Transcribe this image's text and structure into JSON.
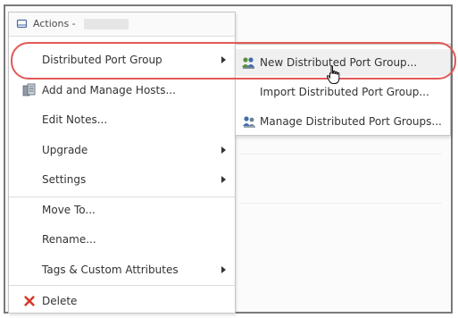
{
  "menu": {
    "header": {
      "title": "Actions -",
      "icon": "switch-icon"
    },
    "items": [
      {
        "label": "Distributed Port Group",
        "icon": "",
        "has_submenu": true
      },
      {
        "label": "Add and Manage Hosts...",
        "icon": "hosts-icon",
        "has_submenu": false
      },
      {
        "label": "Edit Notes...",
        "icon": "",
        "has_submenu": false
      },
      {
        "label": "Upgrade",
        "icon": "",
        "has_submenu": true
      },
      {
        "label": "Settings",
        "icon": "",
        "has_submenu": true
      },
      {
        "label": "Move To...",
        "icon": "",
        "has_submenu": false
      },
      {
        "label": "Rename...",
        "icon": "",
        "has_submenu": false
      },
      {
        "label": "Tags & Custom Attributes",
        "icon": "",
        "has_submenu": true
      },
      {
        "label": "Delete",
        "icon": "delete-icon",
        "has_submenu": false
      }
    ]
  },
  "submenu": {
    "items": [
      {
        "label": "New Distributed Port Group...",
        "icon": "new-port-group-icon",
        "hovered": true
      },
      {
        "label": "Import Distributed Port Group...",
        "icon": "",
        "hovered": false
      },
      {
        "label": "Manage Distributed Port Groups...",
        "icon": "manage-port-groups-icon",
        "hovered": false
      }
    ]
  },
  "colors": {
    "highlight_ring": "#e05a56",
    "delete_icon": "#d63a2a",
    "menu_border": "#c5c5c5",
    "frame_border": "#7a7a7a"
  }
}
